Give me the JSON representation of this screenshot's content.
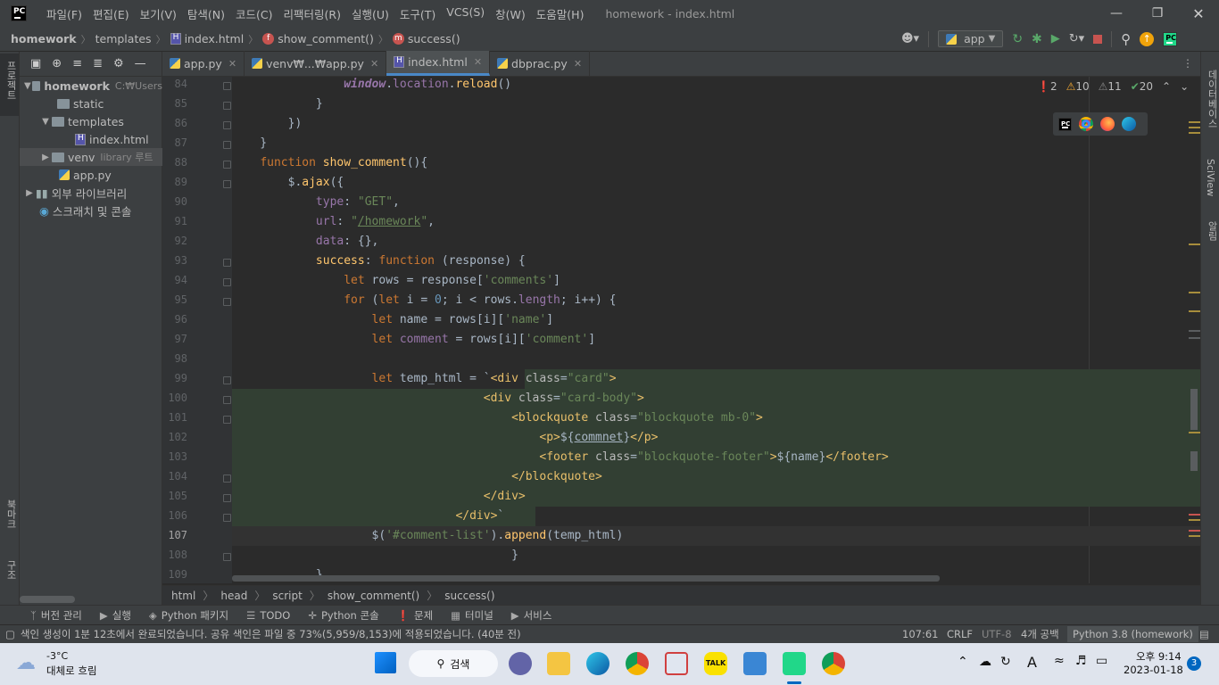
{
  "titlebar": {
    "menu": [
      "파일(F)",
      "편집(E)",
      "보기(V)",
      "탐색(N)",
      "코드(C)",
      "리팩터링(R)",
      "실행(U)",
      "도구(T)",
      "VCS(S)",
      "창(W)",
      "도움말(H)"
    ],
    "title": "homework - index.html",
    "logo": "PC"
  },
  "navbar": {
    "crumbs": [
      "homework",
      "templates",
      "index.html",
      "show_comment()",
      "success()"
    ],
    "run_config": "app"
  },
  "left_strip": {
    "project": "프로젝트",
    "bookmarks": "북마크",
    "structure": "구조"
  },
  "right_strip": {
    "database": "데이터베이스",
    "sciview": "SciView",
    "notifications": "알림"
  },
  "project": {
    "root": "homework",
    "root_path": "C:₩Users",
    "static": "static",
    "templates": "templates",
    "index": "index.html",
    "venv": "venv",
    "venv_hint": "library 루트",
    "app": "app.py",
    "ext_libs": "외부 라이브러리",
    "scratches": "스크래치 및 콘솔"
  },
  "tabs": [
    {
      "label": "app.py",
      "icon": "python-file-icon"
    },
    {
      "label": "venv₩...₩app.py",
      "icon": "python-file-icon"
    },
    {
      "label": "index.html",
      "icon": "html-file-icon"
    },
    {
      "label": "dbprac.py",
      "icon": "python-file-icon"
    }
  ],
  "inspection": {
    "errors": "2",
    "warnings": "10",
    "weak": "11",
    "ok": "20"
  },
  "editor": {
    "line_numbers": [
      "84",
      "85",
      "86",
      "87",
      "88",
      "89",
      "90",
      "91",
      "92",
      "93",
      "94",
      "95",
      "96",
      "97",
      "98",
      "99",
      "100",
      "101",
      "102",
      "103",
      "104",
      "105",
      "106",
      "107",
      "108",
      "109"
    ],
    "current_line": "107"
  },
  "editor_breadcrumb": [
    "html",
    "head",
    "script",
    "show_comment()",
    "success()"
  ],
  "toolwindows": [
    "버전 관리",
    "실행",
    "Python 패키지",
    "TODO",
    "Python 콘솔",
    "문제",
    "터미널",
    "서비스"
  ],
  "status": {
    "message": "색인 생성이 1분 12초에서 완료되었습니다. 공유 색인은 파일 중 73%(5,959/8,153)에 적용되었습니다. (40분 전)",
    "position": "107:61",
    "line_sep": "CRLF",
    "encoding": "UTF-8",
    "indent": "4개 공백",
    "interpreter": "Python 3.8 (homework)"
  },
  "taskbar": {
    "temp": "-3°C",
    "weather": "대체로 흐림",
    "search": "검색",
    "time": "오후 9:14",
    "date": "2023-01-18",
    "badge": "3",
    "lang": "A"
  },
  "colors": {
    "keyword": "#cc7832",
    "string": "#6a8759",
    "function": "#ffc66d",
    "property": "#9876aa",
    "number": "#6897bb",
    "tag": "#e8bf6a",
    "default": "#a9b7c6"
  }
}
